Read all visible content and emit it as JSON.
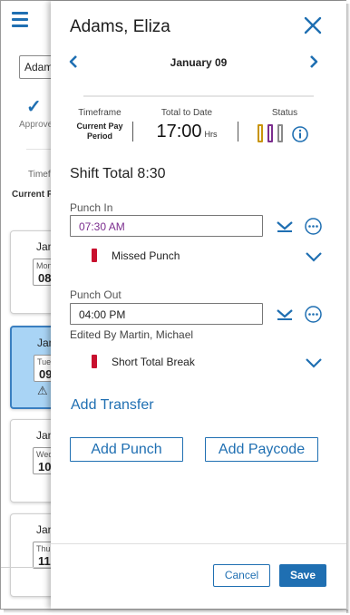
{
  "background": {
    "select_text": "Adams",
    "approve_label": "Approve",
    "timeframe_label": "Timef",
    "current_label": "Current P",
    "day_cards": [
      {
        "month": "Jan",
        "dow": "Mon",
        "num": "08",
        "selected": false,
        "warning": false
      },
      {
        "month": "Jan",
        "dow": "Tue",
        "num": "09",
        "selected": true,
        "warning": true
      },
      {
        "month": "Jan",
        "dow": "Wed",
        "num": "10",
        "selected": false,
        "warning": false
      },
      {
        "month": "Jan",
        "dow": "Thu",
        "num": "11",
        "selected": false,
        "warning": false
      }
    ]
  },
  "panel": {
    "employee_name": "Adams, Eliza",
    "date": "January 09",
    "summary": {
      "timeframe_label": "Timeframe",
      "timeframe_value": "Current Pay Period",
      "total_label": "Total to Date",
      "total_value": "17:00",
      "total_unit": "Hrs",
      "status_label": "Status",
      "status_colors": [
        "#c8940a",
        "#7b2d8e",
        "#8a8a8a"
      ]
    },
    "shift_total_label": "Shift Total",
    "shift_total_value": "8:30",
    "punch_in": {
      "label": "Punch In",
      "value": "07:30 AM",
      "exception": "Missed Punch"
    },
    "punch_out": {
      "label": "Punch Out",
      "value": "04:00 PM",
      "edited_by": "Edited By Martin, Michael",
      "exception": "Short Total Break"
    },
    "add_transfer": "Add Transfer",
    "add_punch": "Add Punch",
    "add_paycode": "Add Paycode",
    "cancel": "Cancel",
    "save": "Save",
    "accent_color": "#1f6fb2",
    "exception_color": "#c8102e"
  }
}
